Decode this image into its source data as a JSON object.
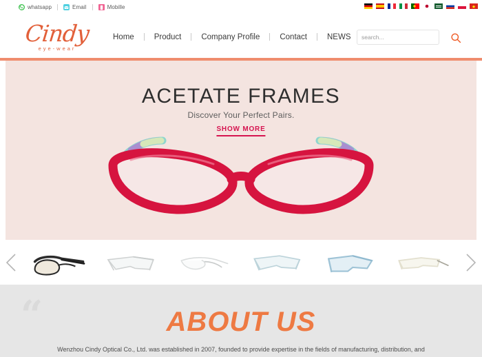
{
  "topbar": {
    "contacts": [
      {
        "icon": "whatsapp-icon",
        "label": "whatsapp"
      },
      {
        "icon": "email-icon",
        "label": "Email"
      },
      {
        "icon": "mobile-icon",
        "label": "Mobille"
      }
    ],
    "languages": [
      {
        "name": "germany-flag",
        "code": "de"
      },
      {
        "name": "spain-flag",
        "code": "es"
      },
      {
        "name": "france-flag",
        "code": "fr"
      },
      {
        "name": "italy-flag",
        "code": "it"
      },
      {
        "name": "portugal-flag",
        "code": "pt"
      },
      {
        "name": "japan-flag",
        "code": "jp"
      },
      {
        "name": "saudi-arabia-flag",
        "code": "sa"
      },
      {
        "name": "russia-flag",
        "code": "ru"
      },
      {
        "name": "poland-flag",
        "code": "pl"
      },
      {
        "name": "vietnam-flag",
        "code": "vn"
      }
    ]
  },
  "header": {
    "logo": {
      "word": "Cindy",
      "tagline": "eye-wear"
    },
    "nav": [
      {
        "label": "Home"
      },
      {
        "label": "Product"
      },
      {
        "label": "Company Profile"
      },
      {
        "label": "Contact"
      },
      {
        "label": "NEWS"
      }
    ],
    "search": {
      "placeholder": "search...",
      "icon": "search-icon"
    }
  },
  "hero": {
    "title": "ACETATE FRAMES",
    "subtitle": "Discover Your Perfect Pairs.",
    "cta": "SHOW MORE",
    "product": "red cat-eye acetate eyeglasses"
  },
  "carousel": {
    "prev_icon": "chevron-left-icon",
    "next_icon": "chevron-right-icon",
    "thumbs": [
      {
        "name": "thumb-black-browline",
        "frame": "#2b2b2b",
        "lens": "#d8cfc0"
      },
      {
        "name": "thumb-white-rectangle",
        "frame": "#cfd2d2",
        "lens": "#f2f4f4"
      },
      {
        "name": "thumb-clear-thin",
        "frame": "#d9dcdc",
        "lens": "#fafbfb"
      },
      {
        "name": "thumb-pale-blue",
        "frame": "#bcd3da",
        "lens": "#eef5f7"
      },
      {
        "name": "thumb-blue-square",
        "frame": "#9ec3d6",
        "lens": "#e3eff5"
      },
      {
        "name": "thumb-cream-metal",
        "frame": "#e3e0cf",
        "lens": "#f7f6ee"
      }
    ]
  },
  "about": {
    "quote_mark": "“",
    "title": "ABOUT US",
    "body": "Wenzhou Cindy Optical Co., Ltd. was established in 2007, founded to provide expertise in the fields of manufacturing, distribution, and"
  },
  "colors": {
    "brand_orange": "#e2603a",
    "hero_bg": "#f4e4e0",
    "hero_rule": "#ef8c6d",
    "cta_crimson": "#d6134f",
    "about_bg": "#e6e6e6",
    "about_title": "#ee7a43"
  }
}
